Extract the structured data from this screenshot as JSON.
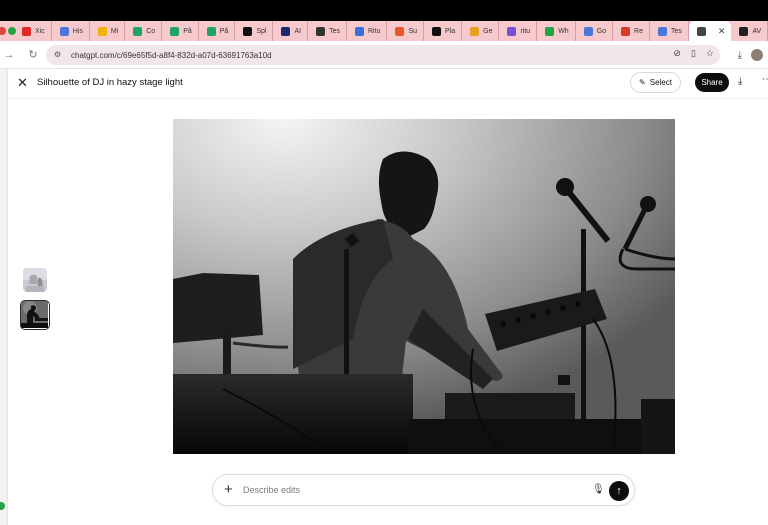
{
  "browser": {
    "tabs": [
      {
        "label": "Xic",
        "favicon": "youtube-icon",
        "color": "#e02b2b"
      },
      {
        "label": "His",
        "favicon": "gemini-icon",
        "color": "#4a78d8"
      },
      {
        "label": "Mi",
        "favicon": "drive-icon",
        "color": "#f0b400"
      },
      {
        "label": "Co",
        "favicon": "drive-icon",
        "color": "#1ea362"
      },
      {
        "label": "Pâ",
        "favicon": "drive-icon",
        "color": "#1ea362"
      },
      {
        "label": "Pâ",
        "favicon": "drive-icon",
        "color": "#1ea362"
      },
      {
        "label": "Spl",
        "favicon": "spline-icon",
        "color": "#111111"
      },
      {
        "label": "AI",
        "favicon": "ai-icon",
        "color": "#1a2a6c"
      },
      {
        "label": "Tes",
        "favicon": "app-icon",
        "color": "#333333"
      },
      {
        "label": "Ritu",
        "favicon": "doc-icon",
        "color": "#3c6fd8"
      },
      {
        "label": "Su",
        "favicon": "su-icon",
        "color": "#e8562a"
      },
      {
        "label": "Pla",
        "favicon": "play-icon",
        "color": "#111111"
      },
      {
        "label": "Ge",
        "favicon": "google-icon",
        "color": "#e8a020"
      },
      {
        "label": "ritu",
        "favicon": "ritu-icon",
        "color": "#7a4fd8"
      },
      {
        "label": "Wh",
        "favicon": "whatsapp-icon",
        "color": "#25a244"
      },
      {
        "label": "Go",
        "favicon": "gemini-icon",
        "color": "#4a78d8"
      },
      {
        "label": "Re",
        "favicon": "gmail-icon",
        "color": "#d83a2a"
      },
      {
        "label": "Tes",
        "favicon": "gemini-icon",
        "color": "#4a78d8"
      },
      {
        "label": "",
        "favicon": "chatgpt-icon",
        "color": "#444444",
        "active": true
      },
      {
        "label": "AV",
        "favicon": "av-icon",
        "color": "#222222"
      }
    ],
    "new_tab": "+",
    "url": "chatgpt.com/c/69e65f5d-a8f4-832d-a07d-63691763a10d"
  },
  "header": {
    "title": "Silhouette of DJ in hazy stage light",
    "select_label": "Select",
    "share_label": "Share"
  },
  "composer": {
    "placeholder": "Describe edits"
  }
}
